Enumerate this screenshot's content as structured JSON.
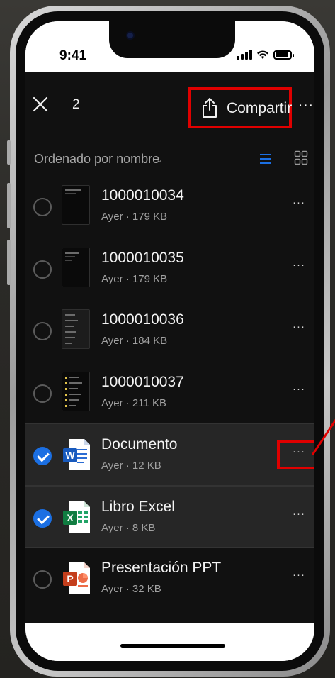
{
  "status_bar": {
    "time": "9:41",
    "signal_bars": 4,
    "battery_level": 0.9
  },
  "toolbar": {
    "close_icon": "close-icon",
    "selected_count": "2",
    "share_label": "Compartir",
    "share_icon": "share-icon",
    "more_icon": "more-horizontal-icon",
    "highlight_color": "#e00000"
  },
  "sort": {
    "label": "Ordenado por nombre",
    "chevron": "⌄",
    "list_view_icon": "list-view-icon",
    "grid_view_icon": "grid-view-icon",
    "active_view": "list",
    "accent_color": "#1b6fe3"
  },
  "files": [
    {
      "name": "1000010034",
      "meta": "Ayer · 179 KB",
      "selected": false,
      "type": "image"
    },
    {
      "name": "1000010035",
      "meta": "Ayer · 179 KB",
      "selected": false,
      "type": "image"
    },
    {
      "name": "1000010036",
      "meta": "Ayer · 184 KB",
      "selected": false,
      "type": "image"
    },
    {
      "name": "1000010037",
      "meta": "Ayer · 211 KB",
      "selected": false,
      "type": "image"
    },
    {
      "name": "Documento",
      "meta": "Ayer · 12 KB",
      "selected": true,
      "type": "word",
      "icon_letter": "W",
      "highlighted_more": true
    },
    {
      "name": "Libro Excel",
      "meta": "Ayer · 8 KB",
      "selected": true,
      "type": "excel",
      "icon_letter": "X"
    },
    {
      "name": "Presentación PPT",
      "meta": "Ayer · 32 KB",
      "selected": false,
      "type": "powerpoint",
      "icon_letter": "P"
    }
  ],
  "row_more_label": "···",
  "top_more_label": "···"
}
